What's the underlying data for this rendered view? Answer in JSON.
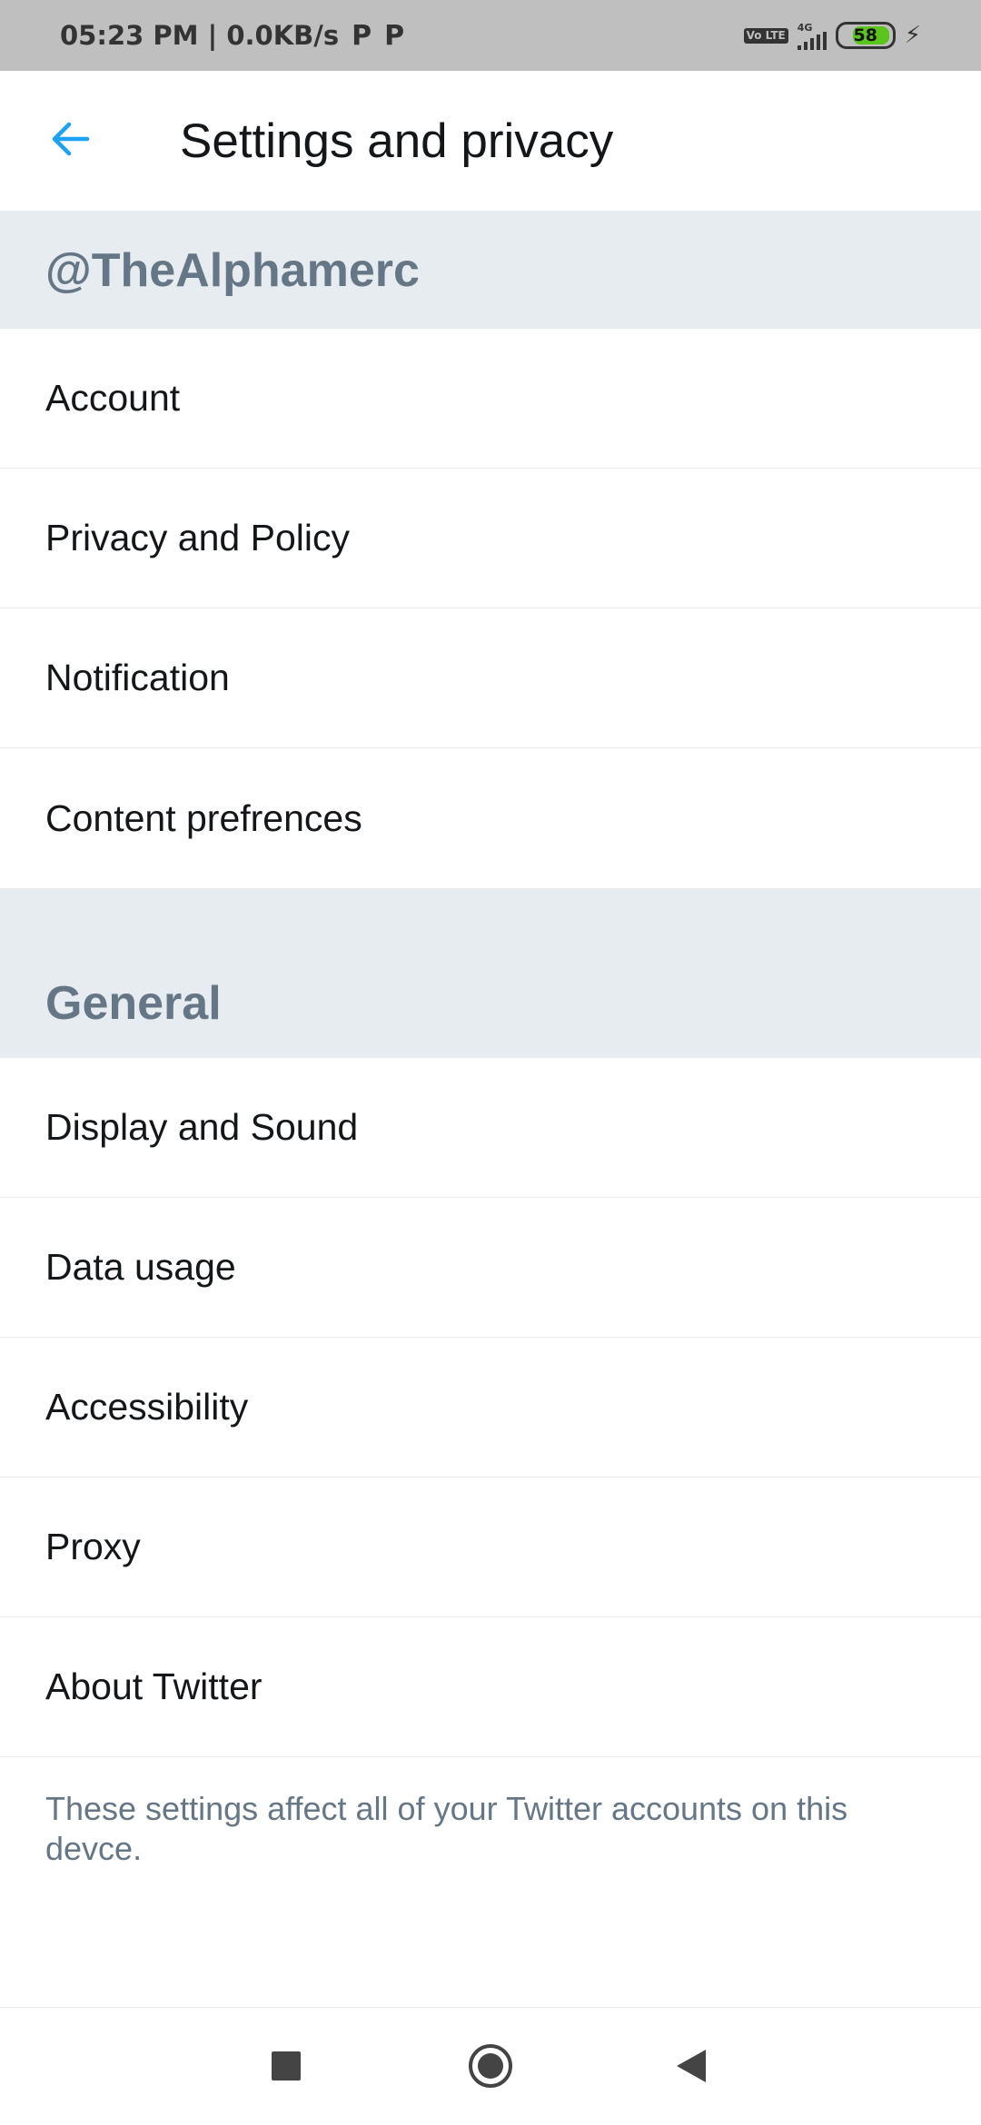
{
  "status_bar": {
    "time": "05:23 PM",
    "net_speed": "| 0.0KB/s",
    "network": "4G",
    "volte": "Vo LTE",
    "battery": "58",
    "battery_color": "#5bc51e"
  },
  "header": {
    "title": "Settings and privacy",
    "back_icon": "arrow-left-icon",
    "accent": "#1da1f2"
  },
  "sections": [
    {
      "title": "@TheAlphamerc",
      "items": [
        "Account",
        "Privacy and Policy",
        "Notification",
        "Content prefrences"
      ]
    },
    {
      "title": "General",
      "items": [
        "Display and Sound",
        "Data usage",
        "Accessibility",
        "Proxy",
        "About Twitter"
      ]
    }
  ],
  "footer_note": "These settings affect all of your Twitter accounts on this devce.",
  "nav_bar": {
    "buttons": [
      "recents-square-icon",
      "home-circle-icon",
      "back-triangle-icon"
    ]
  }
}
